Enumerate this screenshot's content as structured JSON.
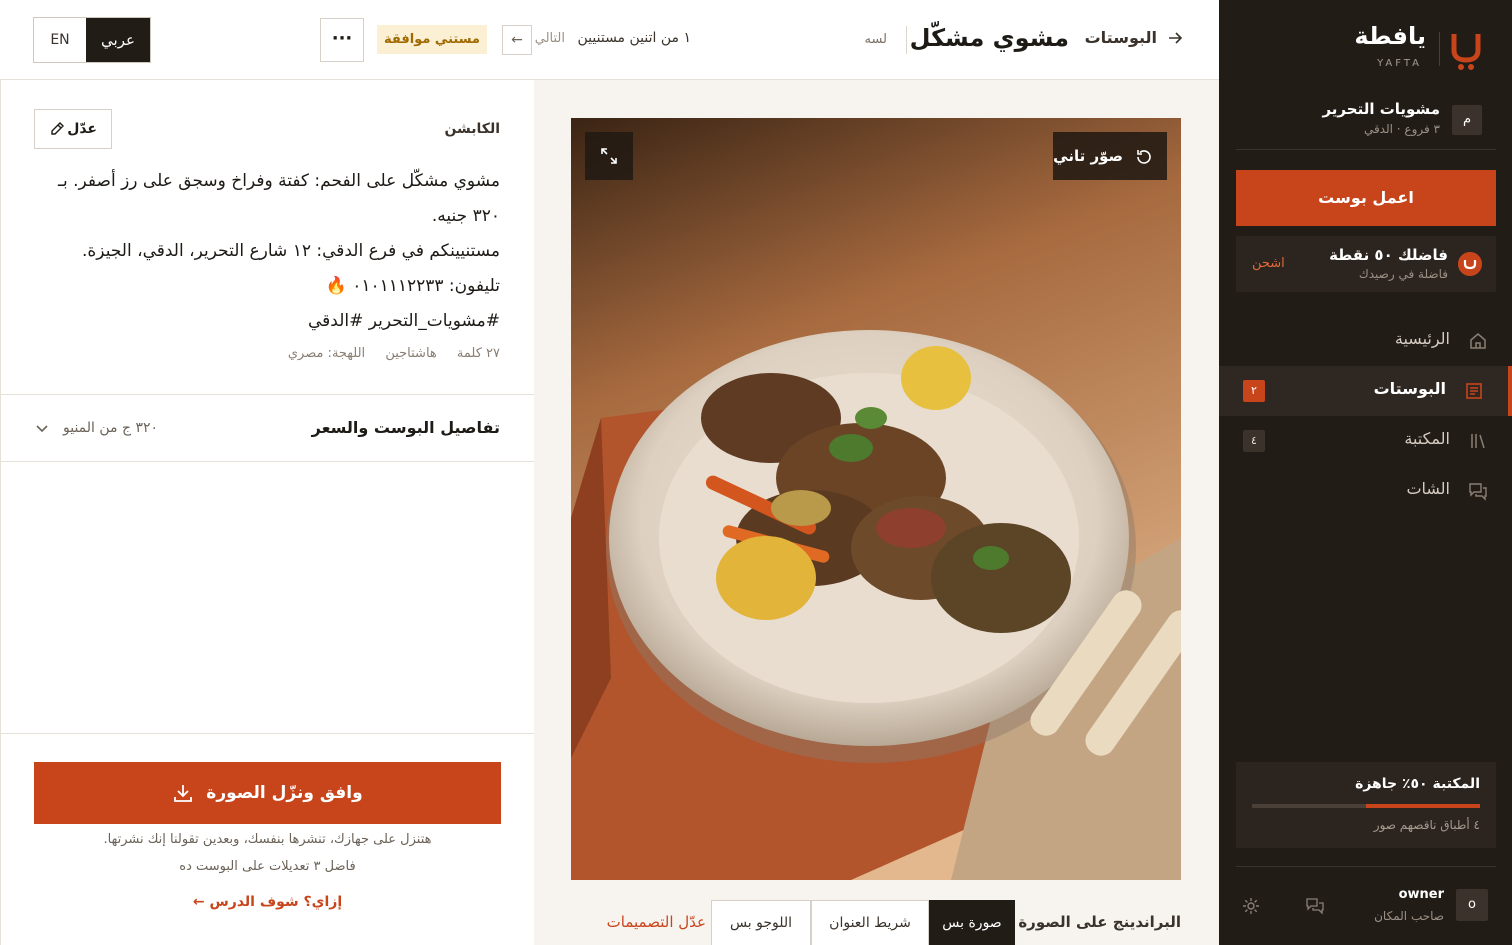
{
  "colors": {
    "accent": "#c8451c",
    "sidebar_bg": "#221c17",
    "review_badge_bg": "#fbf0d3",
    "review_badge_text": "#a16a00"
  },
  "sidebar": {
    "brand": {
      "name": "يافطة",
      "latin": "YAFTA",
      "icon": "yafta-logo-icon"
    },
    "branch": {
      "avatar": "م",
      "name": "مشويات التحرير",
      "meta": "٣ فروع · الدقي"
    },
    "create_post_label": "اعمل بوست",
    "credits": {
      "title": "فاضلك ٥٠ نقطة",
      "subtitle": "فاضلة في رصيدك",
      "link": "اشحن"
    },
    "nav": [
      {
        "label": "الرئيسية",
        "icon": "home-icon",
        "badge": ""
      },
      {
        "label": "البوستات",
        "icon": "posts-icon",
        "badge": "٢",
        "active": true
      },
      {
        "label": "المكتبة",
        "icon": "library-icon",
        "badge": "٤"
      },
      {
        "label": "الشات",
        "icon": "chat-icon",
        "badge": ""
      }
    ],
    "library": {
      "title": "المكتبة ٥٠٪ جاهزة",
      "progress": 0.5,
      "subtitle": "٤ أطباق ناقصهم صور"
    },
    "user": {
      "avatar": "o",
      "name": "owner",
      "role": "صاحب المكان"
    }
  },
  "topbar": {
    "back_label": "البوستات",
    "title": "مشوي مشكّل",
    "status": "لسه",
    "progress": "١ من اتنين مستنيين",
    "next_label": "التالي",
    "prev_symbol": "←",
    "review_badge": "مستني موافقة",
    "more_symbol": "···",
    "lang": {
      "ar": "عربي",
      "en": "EN"
    }
  },
  "preview": {
    "reshoot_label": "صوّر تاني",
    "branding_label": "البراندينج على الصورة",
    "branding_options": [
      "صورة بس",
      "شريط العنوان",
      "اللوجو بس"
    ],
    "branding_selected": "صورة بس",
    "edit_designs": "عدّل التصميمات"
  },
  "caption": {
    "label": "الكابشن",
    "edit_label": "عدّل",
    "lines": [
      "مشوي مشكّل على الفحم: كفتة وفراخ وسجق على رز أصفر. بـ ٣٢٠ جنيه.",
      "مستنيينكم في فرع الدقي: ١٢ شارع التحرير، الدقي، الجيزة.",
      "تليفون: ٠١٠١١١٢٢٣٣ 🔥",
      "#مشويات_التحرير #الدقي"
    ],
    "meta": {
      "words": "٢٧ كلمة",
      "hashtags": "هاشتاجين",
      "dialect": "اللهجة: مصري"
    }
  },
  "details": {
    "title": "تفاصيل البوست والسعر",
    "price": "٣٢٠ ج من المنيو"
  },
  "approve": {
    "label": "وافق ونزّل الصورة",
    "note1": "هتنزل على جهازك، تنشرها بنفسك، وبعدين تقولنا إنك نشرتها.",
    "note2": "فاضل ٣ تعديلات على البوست ده",
    "lesson_link": "إزاي؟ شوف الدرس ←"
  }
}
